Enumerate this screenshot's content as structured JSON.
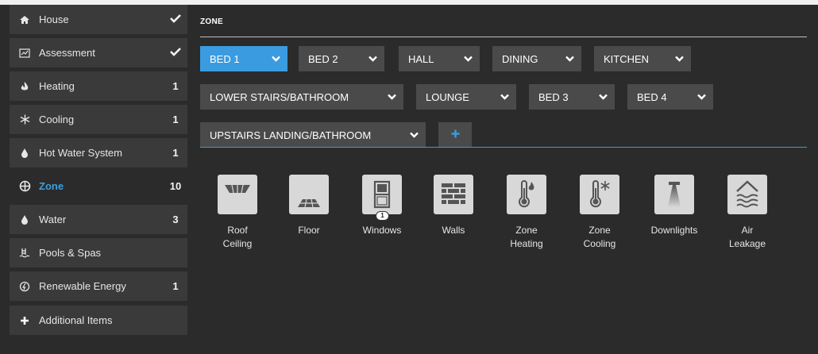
{
  "sidebar": {
    "items": [
      {
        "label": "House",
        "icon": "house-icon",
        "status": "check"
      },
      {
        "label": "Assessment",
        "icon": "assessment-icon",
        "status": "check"
      },
      {
        "label": "Heating",
        "icon": "flame-icon",
        "count": "1"
      },
      {
        "label": "Cooling",
        "icon": "snowflake-icon",
        "count": "1"
      },
      {
        "label": "Hot Water System",
        "icon": "water-drop-icon",
        "count": "1"
      },
      {
        "label": "Zone",
        "icon": "zone-icon",
        "count": "10",
        "active": true
      },
      {
        "label": "Water",
        "icon": "water-drop-icon",
        "count": "3"
      },
      {
        "label": "Pools & Spas",
        "icon": "pool-icon"
      },
      {
        "label": "Renewable Energy",
        "icon": "renewable-energy-icon",
        "count": "1"
      },
      {
        "label": "Additional Items",
        "icon": "plus-icon"
      }
    ]
  },
  "main": {
    "title": "ZONE",
    "tabs": [
      {
        "label": "BED 1",
        "active": true
      },
      {
        "label": "BED 2"
      },
      {
        "label": "HALL"
      },
      {
        "label": "DINING"
      },
      {
        "label": "KITCHEN"
      },
      {
        "label": "LOWER STAIRS/BATHROOM"
      },
      {
        "label": "LOUNGE"
      },
      {
        "label": "BED 3"
      },
      {
        "label": "BED 4"
      },
      {
        "label": "UPSTAIRS LANDING/BATHROOM"
      }
    ],
    "add_tab_icon": "plus-icon",
    "tiles": [
      {
        "label": "Roof\nCeiling",
        "icon": "roof-ceiling-icon"
      },
      {
        "label": "Floor",
        "icon": "floor-icon"
      },
      {
        "label": "Windows",
        "icon": "window-icon",
        "count": "1"
      },
      {
        "label": "Walls",
        "icon": "brick-wall-icon"
      },
      {
        "label": "Zone\nHeating",
        "icon": "thermometer-heat-icon"
      },
      {
        "label": "Zone\nCooling",
        "icon": "thermometer-cool-icon"
      },
      {
        "label": "Downlights",
        "icon": "downlight-icon"
      },
      {
        "label": "Air\nLeakage",
        "icon": "air-leakage-icon"
      }
    ]
  },
  "colors": {
    "background": "#2b2b2b",
    "panel": "#3a3a3a",
    "tab": "#4a4a4a",
    "accent": "#3b9be0",
    "tile": "#d8d8d8"
  }
}
